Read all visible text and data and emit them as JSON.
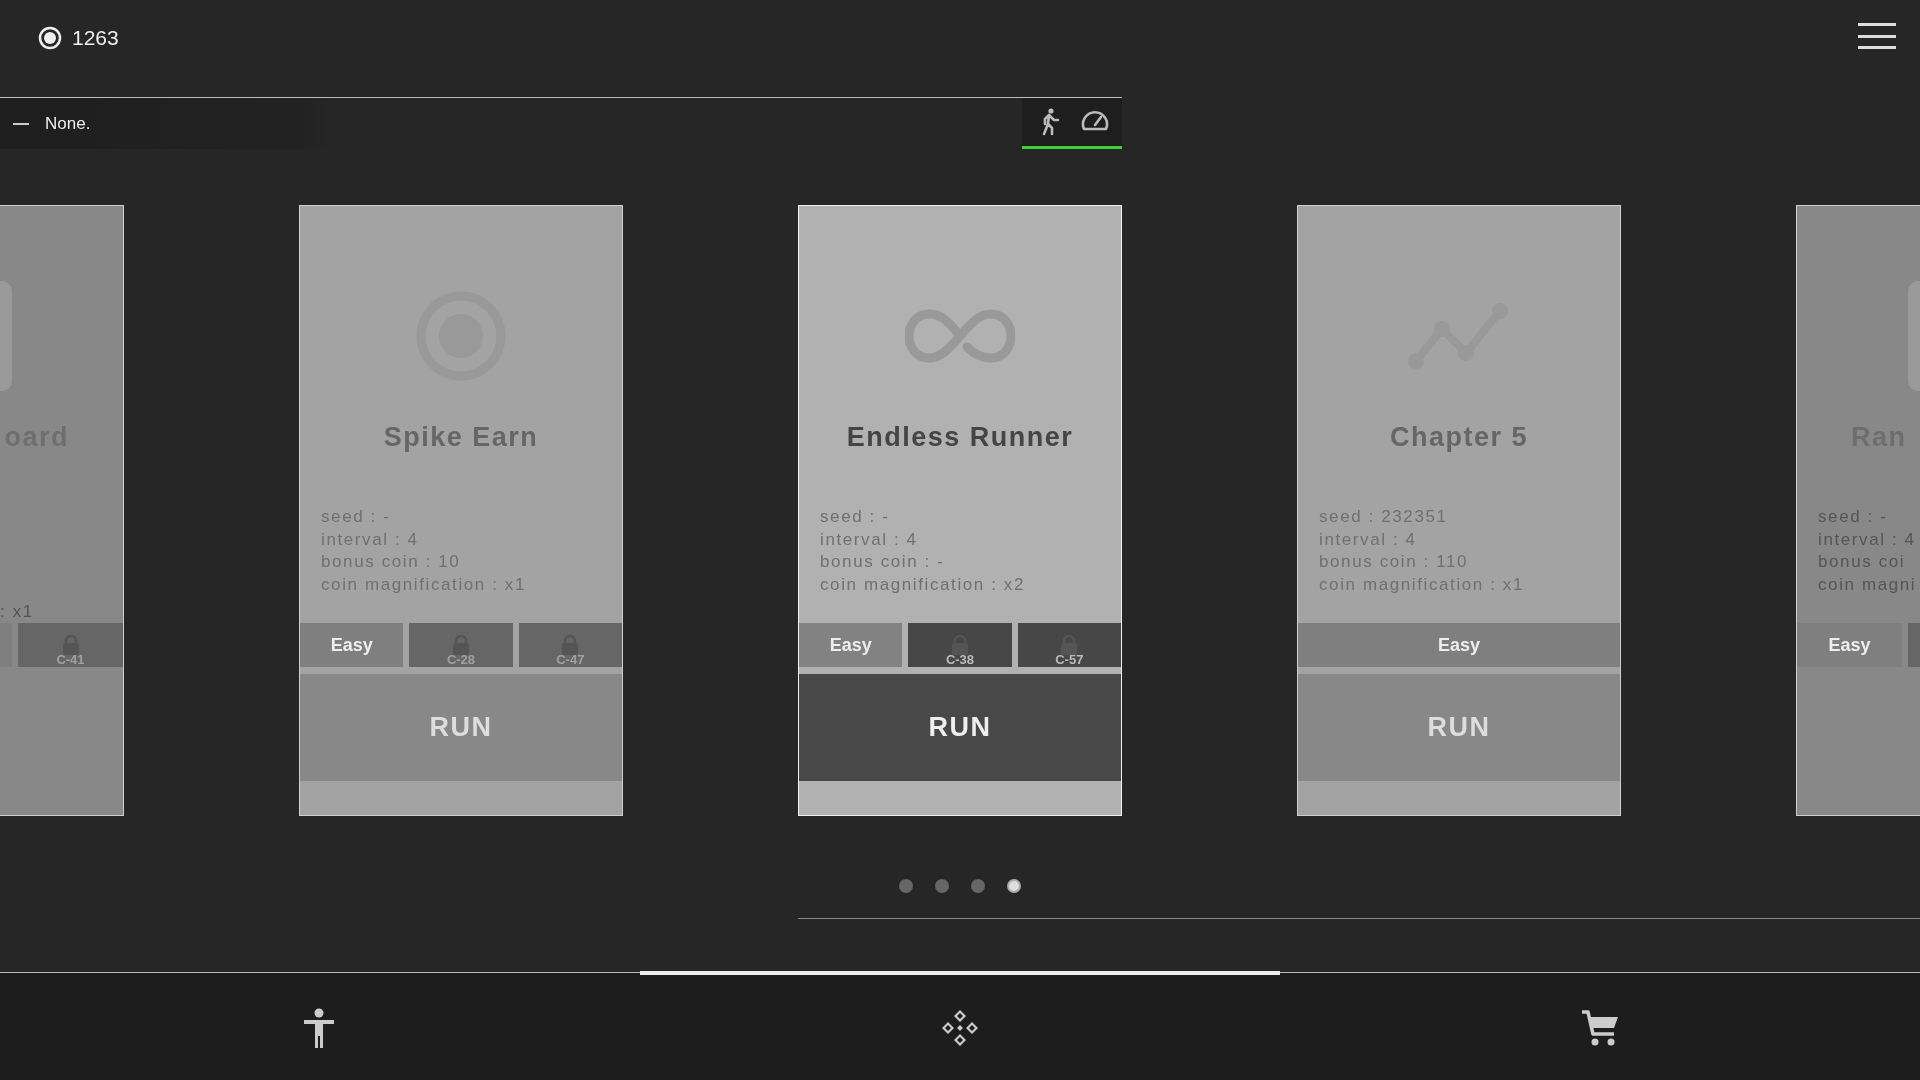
{
  "coins": "1263",
  "status": {
    "text": "None."
  },
  "mode_buttons": [
    {
      "kind": "runner"
    },
    {
      "kind": "speed"
    }
  ],
  "cards": [
    {
      "title": "oard",
      "kind": "tile",
      "stats": [
        ": x1"
      ],
      "difficulties": [
        {
          "locked": false
        },
        {
          "label": "C-41",
          "locked": true
        }
      ],
      "selected": false
    },
    {
      "title": "Spike Earn",
      "kind": "target",
      "stats": [
        "seed : -",
        "interval : 4",
        "bonus coin : 10",
        "coin magnification : x1"
      ],
      "difficulties": [
        {
          "label": "Easy",
          "locked": false
        },
        {
          "label": "C-28",
          "locked": true
        },
        {
          "label": "C-47",
          "locked": true
        }
      ],
      "run_label": "RUN",
      "selected": false
    },
    {
      "title": "Endless Runner",
      "kind": "infinity",
      "stats": [
        "seed : -",
        "interval : 4",
        "bonus coin : -",
        "coin magnification : x2"
      ],
      "difficulties": [
        {
          "label": "Easy",
          "locked": false
        },
        {
          "label": "C-38",
          "locked": true
        },
        {
          "label": "C-57",
          "locked": true
        }
      ],
      "run_label": "RUN",
      "selected": true
    },
    {
      "title": "Chapter 5",
      "kind": "chart",
      "stats": [
        "seed : 232351",
        "interval : 4",
        "bonus coin : 110",
        "coin magnification : x1"
      ],
      "difficulties": [
        {
          "label": "Easy",
          "locked": false
        }
      ],
      "run_label": "RUN",
      "selected": false
    },
    {
      "title": "Ran",
      "kind": "tile",
      "stats": [
        "seed : -",
        "interval : 4",
        "bonus coi",
        "coin magni"
      ],
      "difficulties": [
        {
          "label": "Easy",
          "locked": false
        },
        {
          "locked": true
        }
      ],
      "selected": false
    }
  ],
  "pager": [
    {
      "selected": false
    },
    {
      "selected": false
    },
    {
      "selected": false
    },
    {
      "selected": true
    }
  ],
  "bottom_nav": [
    {
      "kind": "person",
      "selected": false
    },
    {
      "kind": "diamond",
      "selected": true
    },
    {
      "kind": "cart",
      "selected": false
    }
  ]
}
